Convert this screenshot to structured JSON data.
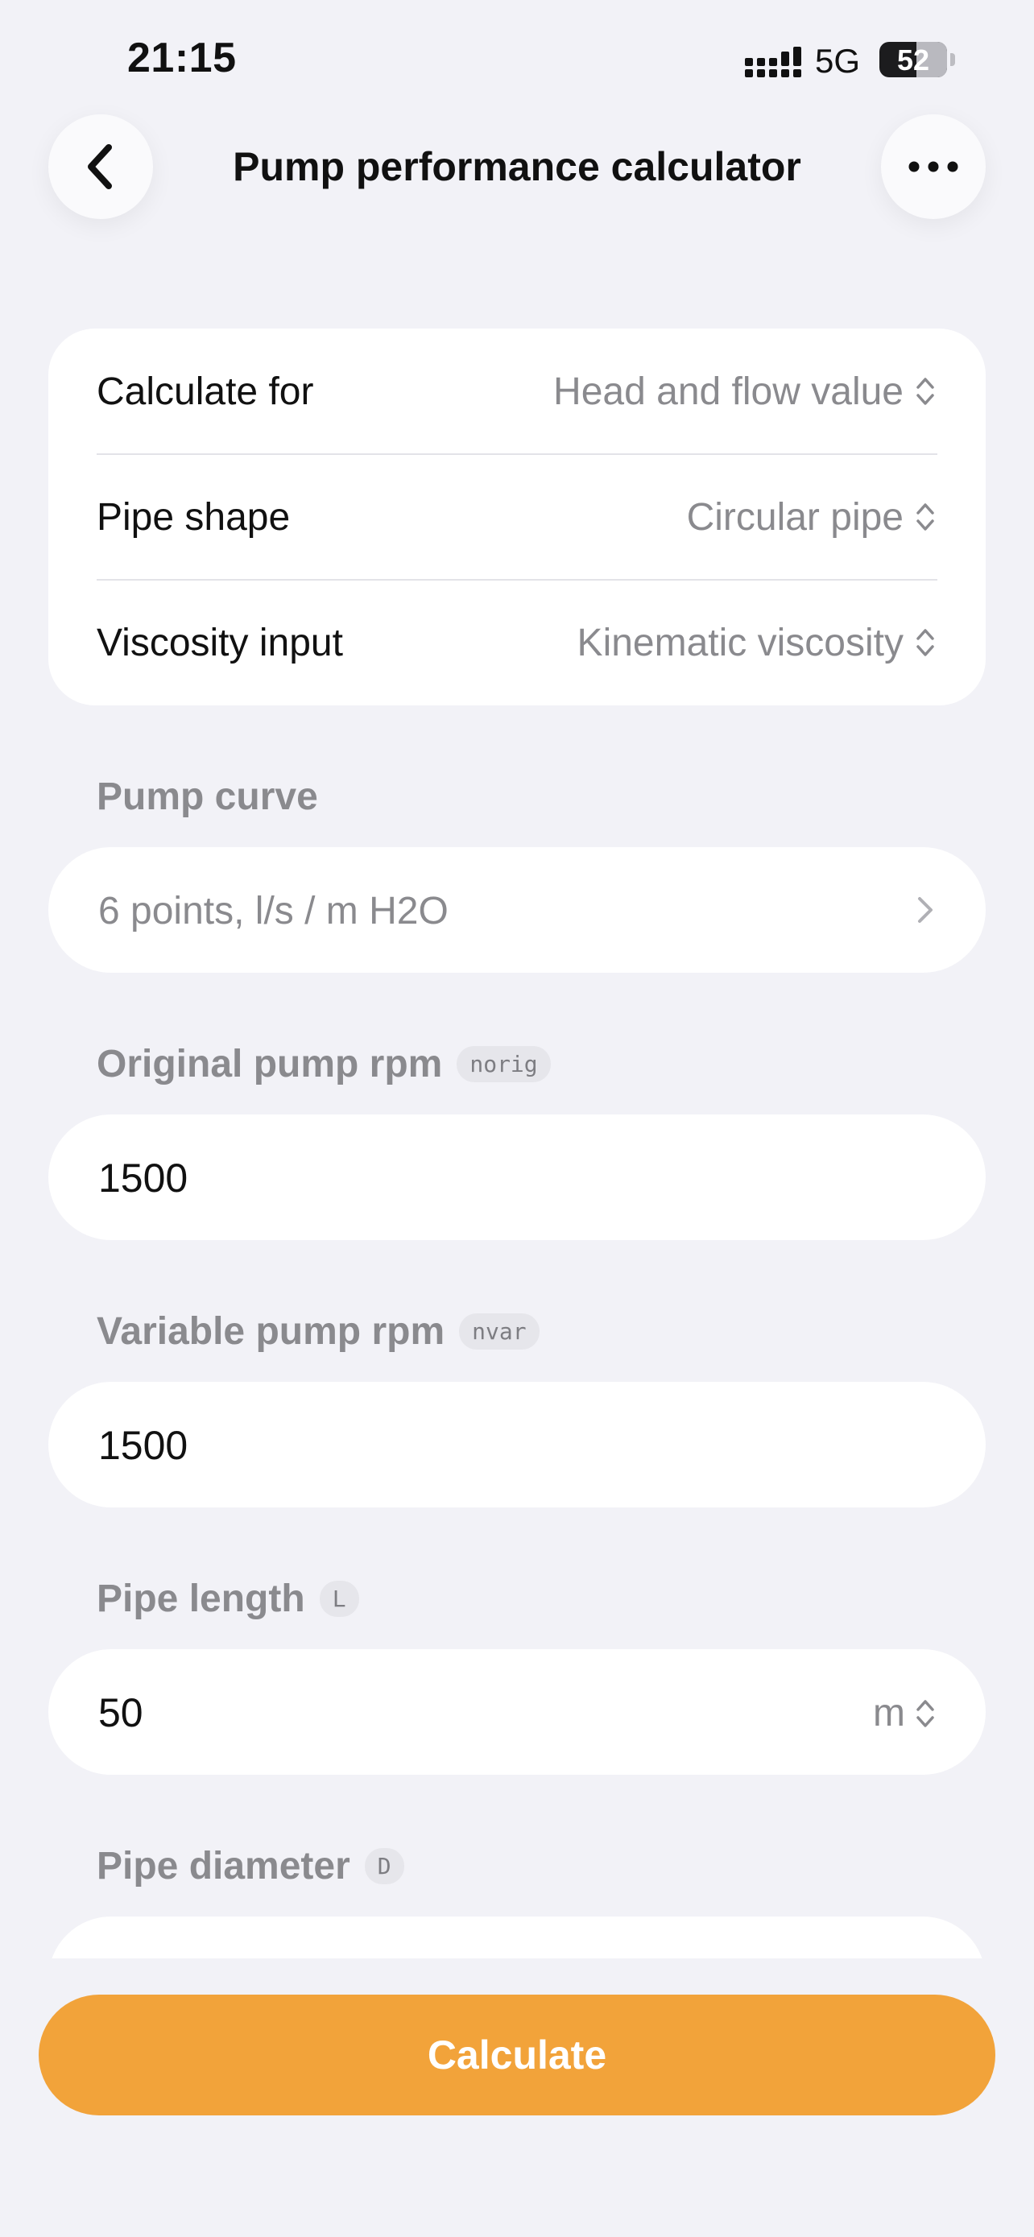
{
  "status": {
    "time": "21:15",
    "network": "5G",
    "battery": "52"
  },
  "nav": {
    "title": "Pump performance calculator"
  },
  "settings": [
    {
      "label": "Calculate for",
      "value": "Head and flow value"
    },
    {
      "label": "Pipe shape",
      "value": "Circular pipe"
    },
    {
      "label": "Viscosity input",
      "value": "Kinematic viscosity"
    }
  ],
  "pump_curve": {
    "label": "Pump curve",
    "value": "6 points, l/s / m H2O"
  },
  "original_rpm": {
    "label": "Original pump rpm",
    "symbol": "norig",
    "value": "1500"
  },
  "variable_rpm": {
    "label": "Variable pump rpm",
    "symbol": "nvar",
    "value": "1500"
  },
  "pipe_length": {
    "label": "Pipe length",
    "symbol": "L",
    "value": "50",
    "unit": "m"
  },
  "pipe_diameter": {
    "label": "Pipe diameter",
    "symbol": "D"
  },
  "actions": {
    "calculate": "Calculate"
  },
  "colors": {
    "accent": "#f2a33a",
    "background": "#f2f2f7"
  }
}
